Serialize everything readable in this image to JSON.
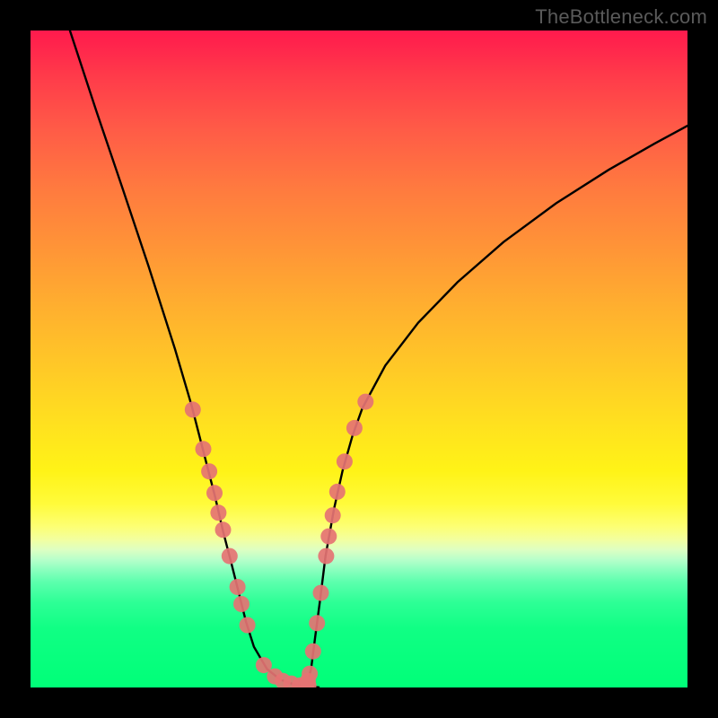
{
  "watermark": "TheBottleneck.com",
  "chart_data": {
    "type": "line",
    "title": "",
    "xlabel": "",
    "ylabel": "",
    "xlim": [
      0,
      1
    ],
    "ylim": [
      0,
      1
    ],
    "series": [
      {
        "name": "curve",
        "x": [
          0.06,
          0.1,
          0.14,
          0.18,
          0.22,
          0.245,
          0.263,
          0.281,
          0.293,
          0.306,
          0.318,
          0.328,
          0.34,
          0.36,
          0.38,
          0.4,
          0.42,
          0.44,
          0.42,
          0.427,
          0.433,
          0.441,
          0.449,
          0.462,
          0.475,
          0.49,
          0.505,
          0.54,
          0.59,
          0.65,
          0.72,
          0.8,
          0.88,
          0.95,
          1.0
        ],
        "y": [
          1.0,
          0.878,
          0.76,
          0.64,
          0.515,
          0.43,
          0.36,
          0.29,
          0.238,
          0.188,
          0.14,
          0.1,
          0.062,
          0.028,
          0.012,
          0.005,
          0.002,
          0.0,
          0.002,
          0.028,
          0.075,
          0.135,
          0.2,
          0.272,
          0.33,
          0.383,
          0.425,
          0.49,
          0.555,
          0.617,
          0.678,
          0.737,
          0.788,
          0.828,
          0.855
        ]
      }
    ],
    "markers": [
      {
        "x": 0.247,
        "y": 0.423
      },
      {
        "x": 0.263,
        "y": 0.363
      },
      {
        "x": 0.272,
        "y": 0.329
      },
      {
        "x": 0.28,
        "y": 0.296
      },
      {
        "x": 0.286,
        "y": 0.266
      },
      {
        "x": 0.293,
        "y": 0.24
      },
      {
        "x": 0.303,
        "y": 0.2
      },
      {
        "x": 0.315,
        "y": 0.153
      },
      {
        "x": 0.321,
        "y": 0.127
      },
      {
        "x": 0.33,
        "y": 0.095
      },
      {
        "x": 0.355,
        "y": 0.034
      },
      {
        "x": 0.372,
        "y": 0.017
      },
      {
        "x": 0.384,
        "y": 0.01
      },
      {
        "x": 0.397,
        "y": 0.006
      },
      {
        "x": 0.41,
        "y": 0.003
      },
      {
        "x": 0.423,
        "y": 0.003
      },
      {
        "x": 0.42,
        "y": 0.005
      },
      {
        "x": 0.422,
        "y": 0.01
      },
      {
        "x": 0.425,
        "y": 0.021
      },
      {
        "x": 0.43,
        "y": 0.055
      },
      {
        "x": 0.436,
        "y": 0.098
      },
      {
        "x": 0.442,
        "y": 0.144
      },
      {
        "x": 0.45,
        "y": 0.2
      },
      {
        "x": 0.454,
        "y": 0.23
      },
      {
        "x": 0.46,
        "y": 0.262
      },
      {
        "x": 0.467,
        "y": 0.298
      },
      {
        "x": 0.478,
        "y": 0.344
      },
      {
        "x": 0.493,
        "y": 0.395
      },
      {
        "x": 0.51,
        "y": 0.435
      }
    ],
    "gradient_bands": [
      {
        "color": "#ff1a4d",
        "stop": 0.0
      },
      {
        "color": "#ff7a3f",
        "stop": 0.24
      },
      {
        "color": "#ffe11f",
        "stop": 0.6
      },
      {
        "color": "#fffb3a",
        "stop": 0.72
      },
      {
        "color": "#b8ffca",
        "stop": 0.805
      },
      {
        "color": "#00ff78",
        "stop": 1.0
      }
    ],
    "marker_color": "#e57373",
    "curve_color": "#000000"
  }
}
